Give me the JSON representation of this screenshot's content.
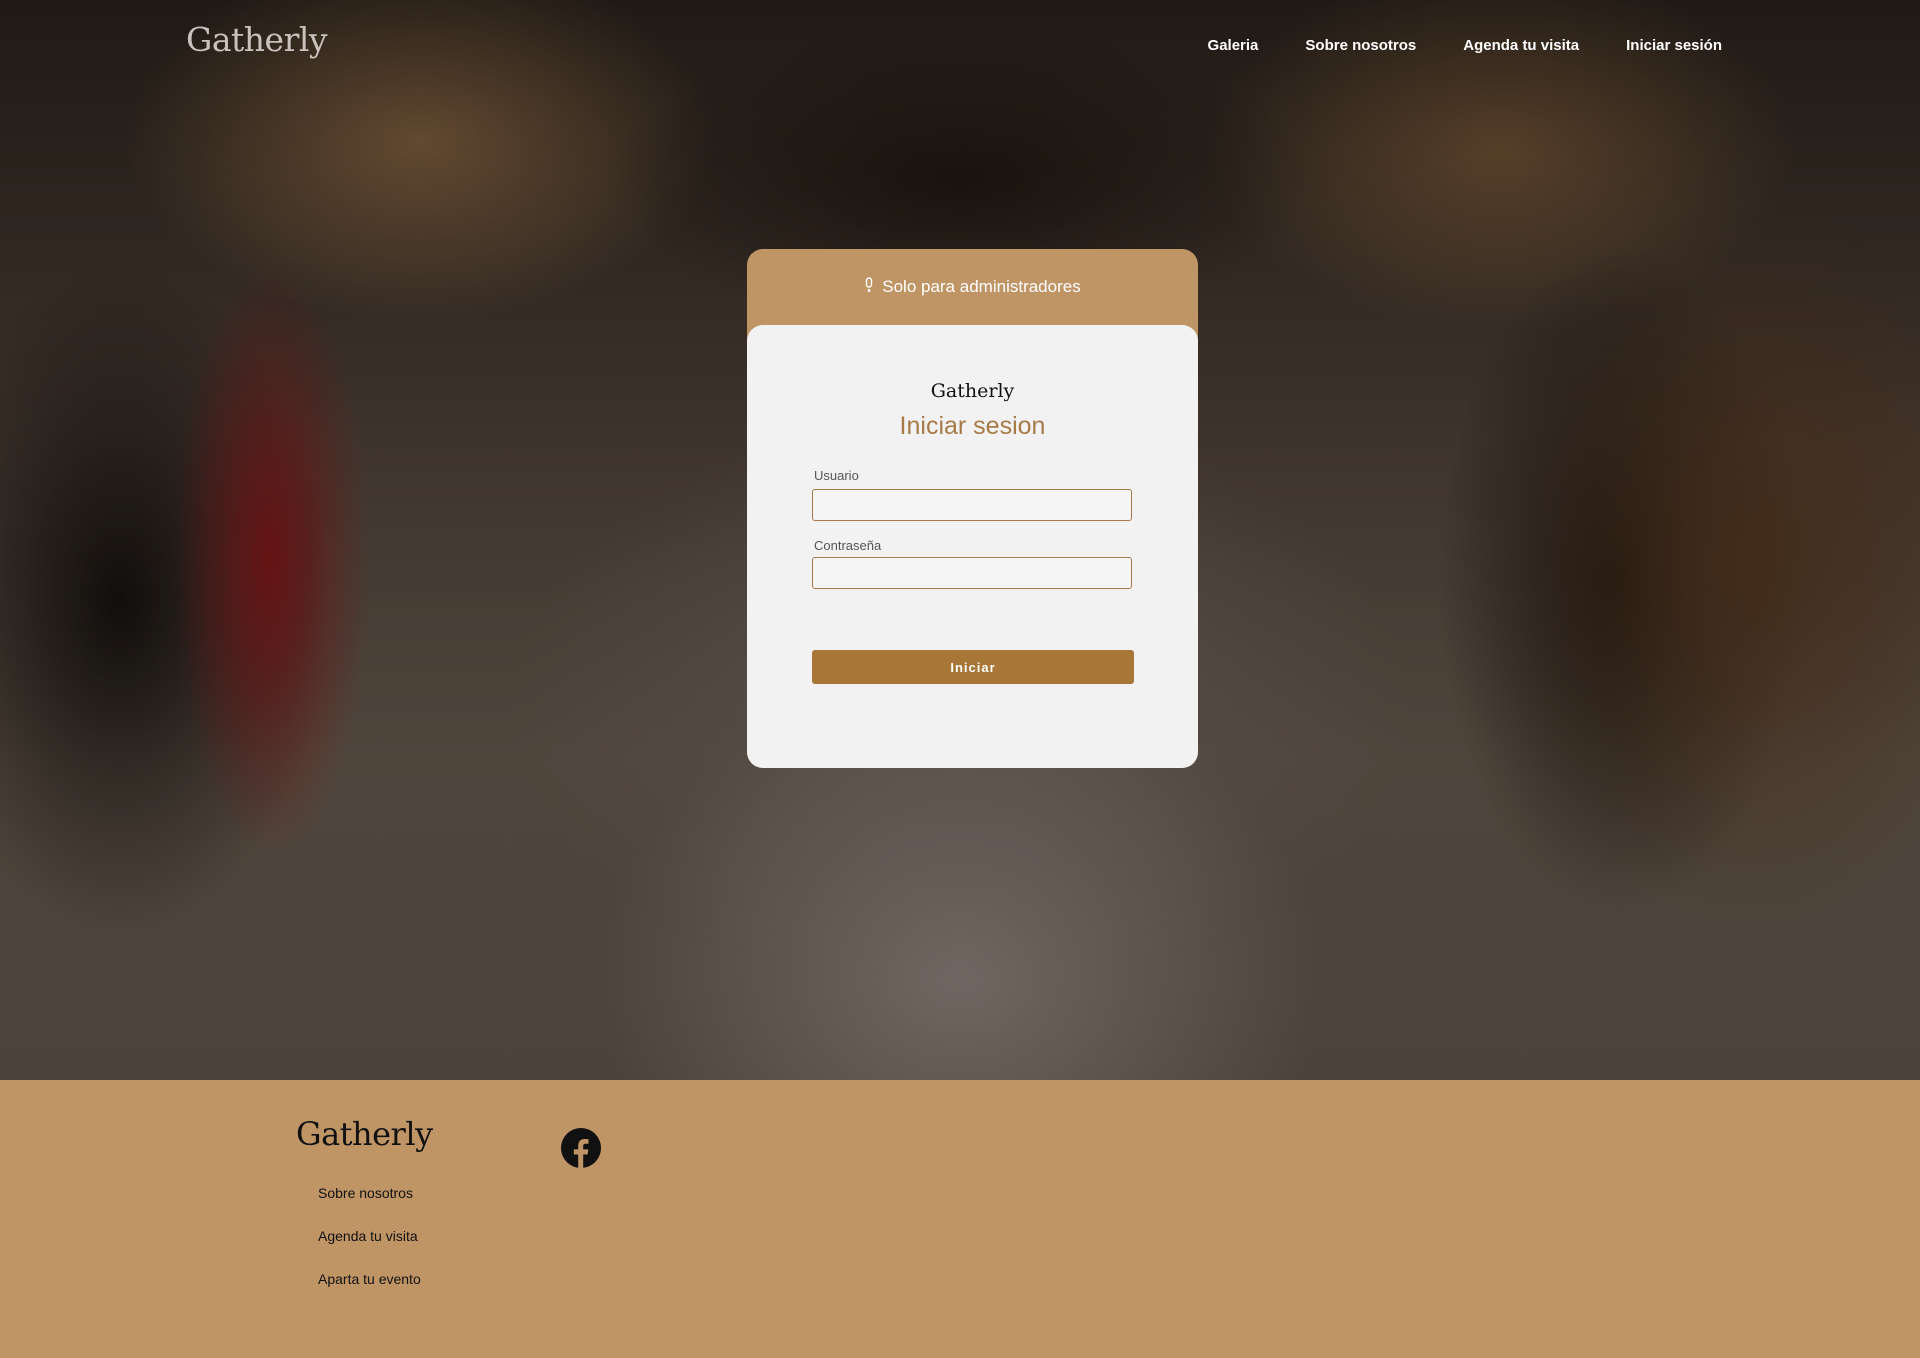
{
  "header": {
    "brand": "Gatherly",
    "nav": [
      "Galeria",
      "Sobre nosotros",
      "Agenda tu visita",
      "Iniciar sesión"
    ]
  },
  "login_card": {
    "notice": "Solo para administradores",
    "notice_icon": "info-icon",
    "brand": "Gatherly",
    "title": "Iniciar sesion",
    "username_label": "Usuario",
    "username_value": "",
    "password_label": "Contraseña",
    "password_value": "",
    "submit_label": "Iniciar"
  },
  "footer": {
    "brand": "Gatherly",
    "links": [
      "Sobre nosotros",
      "Agenda tu visita",
      "Aparta tu evento"
    ],
    "social_icon": "facebook-icon"
  },
  "colors": {
    "accent": "#c09566",
    "button": "#a87636",
    "title": "#a87a48"
  }
}
